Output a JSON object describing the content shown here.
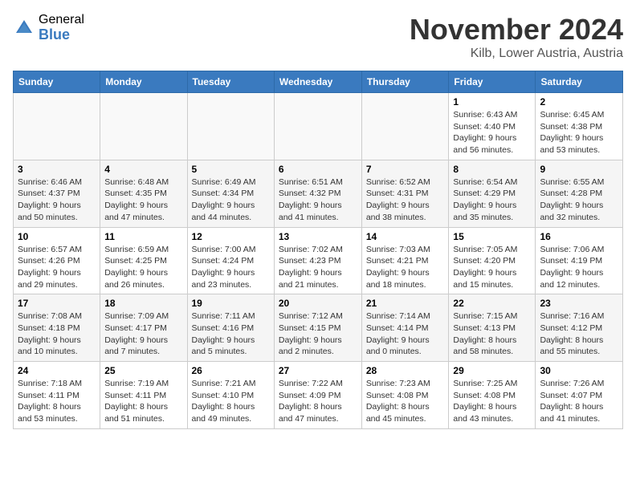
{
  "header": {
    "logo_general": "General",
    "logo_blue": "Blue",
    "month_title": "November 2024",
    "location": "Kilb, Lower Austria, Austria"
  },
  "weekdays": [
    "Sunday",
    "Monday",
    "Tuesday",
    "Wednesday",
    "Thursday",
    "Friday",
    "Saturday"
  ],
  "weeks": [
    [
      {
        "day": "",
        "info": ""
      },
      {
        "day": "",
        "info": ""
      },
      {
        "day": "",
        "info": ""
      },
      {
        "day": "",
        "info": ""
      },
      {
        "day": "",
        "info": ""
      },
      {
        "day": "1",
        "info": "Sunrise: 6:43 AM\nSunset: 4:40 PM\nDaylight: 9 hours\nand 56 minutes."
      },
      {
        "day": "2",
        "info": "Sunrise: 6:45 AM\nSunset: 4:38 PM\nDaylight: 9 hours\nand 53 minutes."
      }
    ],
    [
      {
        "day": "3",
        "info": "Sunrise: 6:46 AM\nSunset: 4:37 PM\nDaylight: 9 hours\nand 50 minutes."
      },
      {
        "day": "4",
        "info": "Sunrise: 6:48 AM\nSunset: 4:35 PM\nDaylight: 9 hours\nand 47 minutes."
      },
      {
        "day": "5",
        "info": "Sunrise: 6:49 AM\nSunset: 4:34 PM\nDaylight: 9 hours\nand 44 minutes."
      },
      {
        "day": "6",
        "info": "Sunrise: 6:51 AM\nSunset: 4:32 PM\nDaylight: 9 hours\nand 41 minutes."
      },
      {
        "day": "7",
        "info": "Sunrise: 6:52 AM\nSunset: 4:31 PM\nDaylight: 9 hours\nand 38 minutes."
      },
      {
        "day": "8",
        "info": "Sunrise: 6:54 AM\nSunset: 4:29 PM\nDaylight: 9 hours\nand 35 minutes."
      },
      {
        "day": "9",
        "info": "Sunrise: 6:55 AM\nSunset: 4:28 PM\nDaylight: 9 hours\nand 32 minutes."
      }
    ],
    [
      {
        "day": "10",
        "info": "Sunrise: 6:57 AM\nSunset: 4:26 PM\nDaylight: 9 hours\nand 29 minutes."
      },
      {
        "day": "11",
        "info": "Sunrise: 6:59 AM\nSunset: 4:25 PM\nDaylight: 9 hours\nand 26 minutes."
      },
      {
        "day": "12",
        "info": "Sunrise: 7:00 AM\nSunset: 4:24 PM\nDaylight: 9 hours\nand 23 minutes."
      },
      {
        "day": "13",
        "info": "Sunrise: 7:02 AM\nSunset: 4:23 PM\nDaylight: 9 hours\nand 21 minutes."
      },
      {
        "day": "14",
        "info": "Sunrise: 7:03 AM\nSunset: 4:21 PM\nDaylight: 9 hours\nand 18 minutes."
      },
      {
        "day": "15",
        "info": "Sunrise: 7:05 AM\nSunset: 4:20 PM\nDaylight: 9 hours\nand 15 minutes."
      },
      {
        "day": "16",
        "info": "Sunrise: 7:06 AM\nSunset: 4:19 PM\nDaylight: 9 hours\nand 12 minutes."
      }
    ],
    [
      {
        "day": "17",
        "info": "Sunrise: 7:08 AM\nSunset: 4:18 PM\nDaylight: 9 hours\nand 10 minutes."
      },
      {
        "day": "18",
        "info": "Sunrise: 7:09 AM\nSunset: 4:17 PM\nDaylight: 9 hours\nand 7 minutes."
      },
      {
        "day": "19",
        "info": "Sunrise: 7:11 AM\nSunset: 4:16 PM\nDaylight: 9 hours\nand 5 minutes."
      },
      {
        "day": "20",
        "info": "Sunrise: 7:12 AM\nSunset: 4:15 PM\nDaylight: 9 hours\nand 2 minutes."
      },
      {
        "day": "21",
        "info": "Sunrise: 7:14 AM\nSunset: 4:14 PM\nDaylight: 9 hours\nand 0 minutes."
      },
      {
        "day": "22",
        "info": "Sunrise: 7:15 AM\nSunset: 4:13 PM\nDaylight: 8 hours\nand 58 minutes."
      },
      {
        "day": "23",
        "info": "Sunrise: 7:16 AM\nSunset: 4:12 PM\nDaylight: 8 hours\nand 55 minutes."
      }
    ],
    [
      {
        "day": "24",
        "info": "Sunrise: 7:18 AM\nSunset: 4:11 PM\nDaylight: 8 hours\nand 53 minutes."
      },
      {
        "day": "25",
        "info": "Sunrise: 7:19 AM\nSunset: 4:11 PM\nDaylight: 8 hours\nand 51 minutes."
      },
      {
        "day": "26",
        "info": "Sunrise: 7:21 AM\nSunset: 4:10 PM\nDaylight: 8 hours\nand 49 minutes."
      },
      {
        "day": "27",
        "info": "Sunrise: 7:22 AM\nSunset: 4:09 PM\nDaylight: 8 hours\nand 47 minutes."
      },
      {
        "day": "28",
        "info": "Sunrise: 7:23 AM\nSunset: 4:08 PM\nDaylight: 8 hours\nand 45 minutes."
      },
      {
        "day": "29",
        "info": "Sunrise: 7:25 AM\nSunset: 4:08 PM\nDaylight: 8 hours\nand 43 minutes."
      },
      {
        "day": "30",
        "info": "Sunrise: 7:26 AM\nSunset: 4:07 PM\nDaylight: 8 hours\nand 41 minutes."
      }
    ]
  ]
}
